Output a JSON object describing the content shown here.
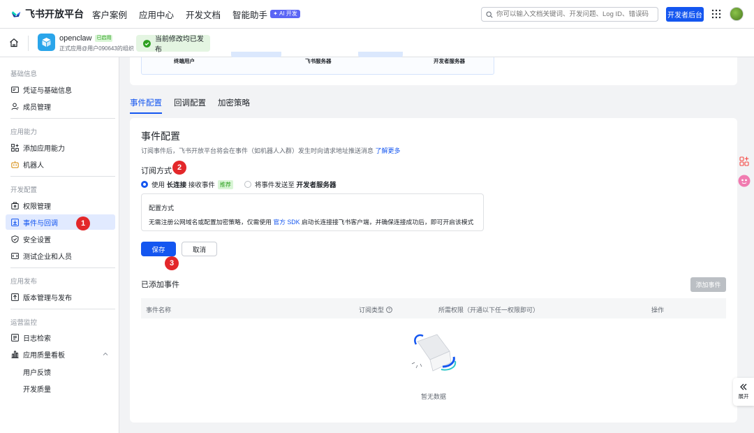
{
  "brand": {
    "name": "飞书开放平台"
  },
  "nav": {
    "items": [
      "客户案例",
      "应用中心",
      "开发文档",
      "智能助手"
    ],
    "ai_badge": "AI 开发",
    "search_placeholder": "你可以输入文档关键词、开发问题、Log ID、错误码",
    "dev_button": "开发者后台"
  },
  "app": {
    "name": "openclaw",
    "status": "已启用",
    "subtitle": "正式应用@用户090643的组织",
    "publish_status": "当前修改均已发布"
  },
  "sidebar": {
    "groups": {
      "basic": "基础信息",
      "ability": "应用能力",
      "dev": "开发配置",
      "release": "应用发布",
      "ops": "运营监控"
    },
    "items": {
      "credentials": "凭证与基础信息",
      "members": "成员管理",
      "add_ability": "添加应用能力",
      "bot": "机器人",
      "permissions": "权限管理",
      "events": "事件与回调",
      "security": "安全设置",
      "test_org": "测试企业和人员",
      "versions": "版本管理与发布",
      "logs": "日志检索",
      "quality": "应用质量看板",
      "feedback": "用户反馈",
      "dev_quality": "开发质量"
    }
  },
  "flow": {
    "end_user": "终端用户",
    "feishu_server": "飞书服务器",
    "dev_server": "开发者服务器"
  },
  "tabs": [
    "事件配置",
    "回调配置",
    "加密策略"
  ],
  "event_config": {
    "title": "事件配置",
    "desc": "订阅事件后，飞书开放平台将会在事件（如机器人入群）发生时向请求地址推送消息",
    "learn_more": "了解更多",
    "sub_method_title": "订阅方式",
    "option1_prefix": "使用",
    "option1_bold": "长连接",
    "option1_suffix": "接收事件",
    "recommend": "推荐",
    "option2_prefix": "将事件发送至",
    "option2_bold": "开发者服务器",
    "mode_title": "配置方式",
    "mode_desc_prefix": "无需注册公网域名或配置加密策略，仅需使用",
    "mode_desc_link": "官方 SDK",
    "mode_desc_suffix": "启动长连接接飞书客户端，并确保连接成功后，即可开启该模式",
    "save": "保存",
    "cancel": "取消"
  },
  "added_events": {
    "title": "已添加事件",
    "add_button": "添加事件",
    "columns": [
      "事件名称",
      "订阅类型",
      "所需权限（开通以下任一权限即可）",
      "操作"
    ],
    "empty": "暂无数据"
  },
  "badges": [
    "1",
    "2",
    "3"
  ],
  "expand_label": "展开",
  "colors": {
    "primary": "#1456f0",
    "badge_red": "#e3272a",
    "success": "#2ea121"
  }
}
